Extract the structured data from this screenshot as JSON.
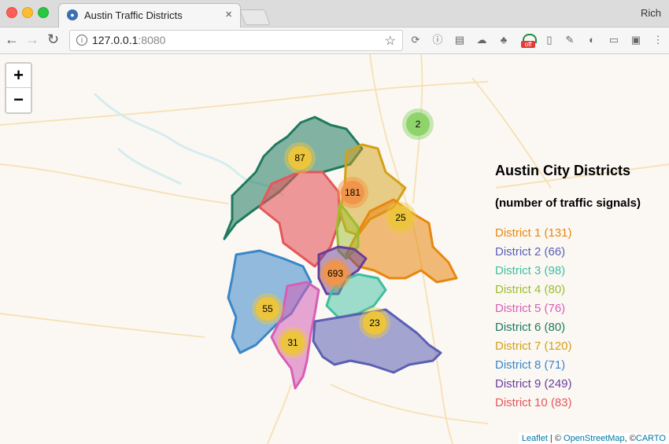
{
  "browser": {
    "tab_title": "Austin Traffic Districts",
    "tab_close": "×",
    "profile_name": "Rich",
    "url_host": "127.0.0.1",
    "url_port": ":8080",
    "info_glyph": "i",
    "ext_off_badge": "off"
  },
  "map": {
    "zoom_in": "+",
    "zoom_out": "−",
    "attribution": {
      "leaflet": "Leaflet",
      "sep1": " | © ",
      "osm": "OpenStreetMap",
      "sep2": ", ©",
      "carto": "CARTO"
    }
  },
  "legend": {
    "title": "Austin City Districts",
    "subtitle": "(number of traffic signals)",
    "items": [
      {
        "label": "District 1 (131)",
        "color": "#e8870f"
      },
      {
        "label": "District 2 (66)",
        "color": "#5b5fb3"
      },
      {
        "label": "District 3 (98)",
        "color": "#3fbf9f"
      },
      {
        "label": "District 4 (80)",
        "color": "#9cbd2e"
      },
      {
        "label": "District 5 (76)",
        "color": "#d65fb6"
      },
      {
        "label": "District 6 (80)",
        "color": "#1f7a5e"
      },
      {
        "label": "District 7 (120)",
        "color": "#d4a017"
      },
      {
        "label": "District 8 (71)",
        "color": "#3a86c8"
      },
      {
        "label": "District 9 (249)",
        "color": "#6a3d9a"
      },
      {
        "label": "District 10 (83)",
        "color": "#e5565a"
      }
    ]
  },
  "clusters": [
    "2",
    "87",
    "181",
    "25",
    "693",
    "55",
    "23",
    "31"
  ]
}
